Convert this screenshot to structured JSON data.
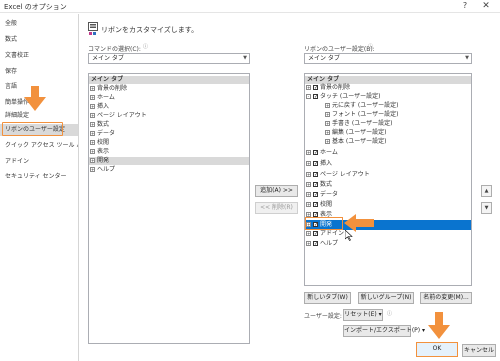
{
  "window": {
    "title": "Excel のオプション",
    "help": "?",
    "close": "✕"
  },
  "nav": {
    "items": [
      "全般",
      "数式",
      "文書校正",
      "保存",
      "言語",
      "簡単操作",
      "詳細設定",
      "リボンのユーザー設定",
      "クイック アクセス ツール バー",
      "アドイン",
      "セキュリティ センター"
    ],
    "selected_index": 7
  },
  "header": {
    "text": "リボンをカスタマイズします。"
  },
  "left": {
    "label": "コマンドの選択(C):",
    "dropdown": "メイン タブ",
    "list_header": "メイン タブ",
    "items": [
      {
        "label": "背景の削除",
        "pm": "+"
      },
      {
        "label": "ホーム",
        "pm": "+"
      },
      {
        "label": "挿入",
        "pm": "+"
      },
      {
        "label": "ページ レイアウト",
        "pm": "+"
      },
      {
        "label": "数式",
        "pm": "+"
      },
      {
        "label": "データ",
        "pm": "+"
      },
      {
        "label": "校閲",
        "pm": "+"
      },
      {
        "label": "表示",
        "pm": "+"
      },
      {
        "label": "開発",
        "pm": "+"
      },
      {
        "label": "ヘルプ",
        "pm": "+"
      }
    ],
    "selected_index": 8
  },
  "middle": {
    "add_button": "追加(A) >>",
    "remove_button": "<< 削除(R)"
  },
  "right": {
    "label": "リボンのユーザー設定(B):",
    "dropdown": "メイン タブ",
    "list_header": "メイン タブ",
    "items": [
      {
        "label": "背景の削除",
        "pm": "+",
        "check": "✓",
        "indent": 0
      },
      {
        "label": "タッチ (ユーザー設定)",
        "pm": "-",
        "check": "✓",
        "indent": 0
      },
      {
        "label": "元に戻す (ユーザー設定)",
        "pm": "+",
        "check": "",
        "indent": 1
      },
      {
        "label": "フォント (ユーザー設定)",
        "pm": "+",
        "check": "",
        "indent": 1
      },
      {
        "label": "手書き (ユーザー設定)",
        "pm": "+",
        "check": "",
        "indent": 1
      },
      {
        "label": "編集 (ユーザー設定)",
        "pm": "+",
        "check": "",
        "indent": 1
      },
      {
        "label": "基本 (ユーザー設定)",
        "pm": "+",
        "check": "",
        "indent": 1
      },
      {
        "label": "ホーム",
        "pm": "+",
        "check": "✓",
        "indent": 0
      },
      {
        "label": "挿入",
        "pm": "+",
        "check": "✓",
        "indent": 0
      },
      {
        "label": "ページ レイアウト",
        "pm": "+",
        "check": "✓",
        "indent": 0
      },
      {
        "label": "数式",
        "pm": "+",
        "check": "✓",
        "indent": 0
      },
      {
        "label": "データ",
        "pm": "+",
        "check": "✓",
        "indent": 0
      },
      {
        "label": "校閲",
        "pm": "+",
        "check": "✓",
        "indent": 0
      },
      {
        "label": "表示",
        "pm": "+",
        "check": "✓",
        "indent": 0
      },
      {
        "label": "開発",
        "pm": "+",
        "check": "✓",
        "indent": 0
      },
      {
        "label": "アドイン",
        "pm": "+",
        "check": "✓",
        "indent": 0
      },
      {
        "label": "ヘルプ",
        "pm": "+",
        "check": "✓",
        "indent": 0
      }
    ],
    "selected_index": 14,
    "move_up": "▲",
    "move_down": "▼",
    "new_tab": "新しいタブ(W)",
    "new_group": "新しいグループ(N)",
    "rename": "名前の変更(M)...",
    "custom_label": "ユーザー設定:",
    "reset": "リセット(E) ▾",
    "import_export": "インポート/エクスポート(P) ▾"
  },
  "footer": {
    "ok": "OK",
    "cancel": "キャンセル"
  },
  "colors": {
    "accent_orange": "#f2913d",
    "selection_blue": "#0a74cf",
    "selection_gray": "#d9d9d9"
  }
}
